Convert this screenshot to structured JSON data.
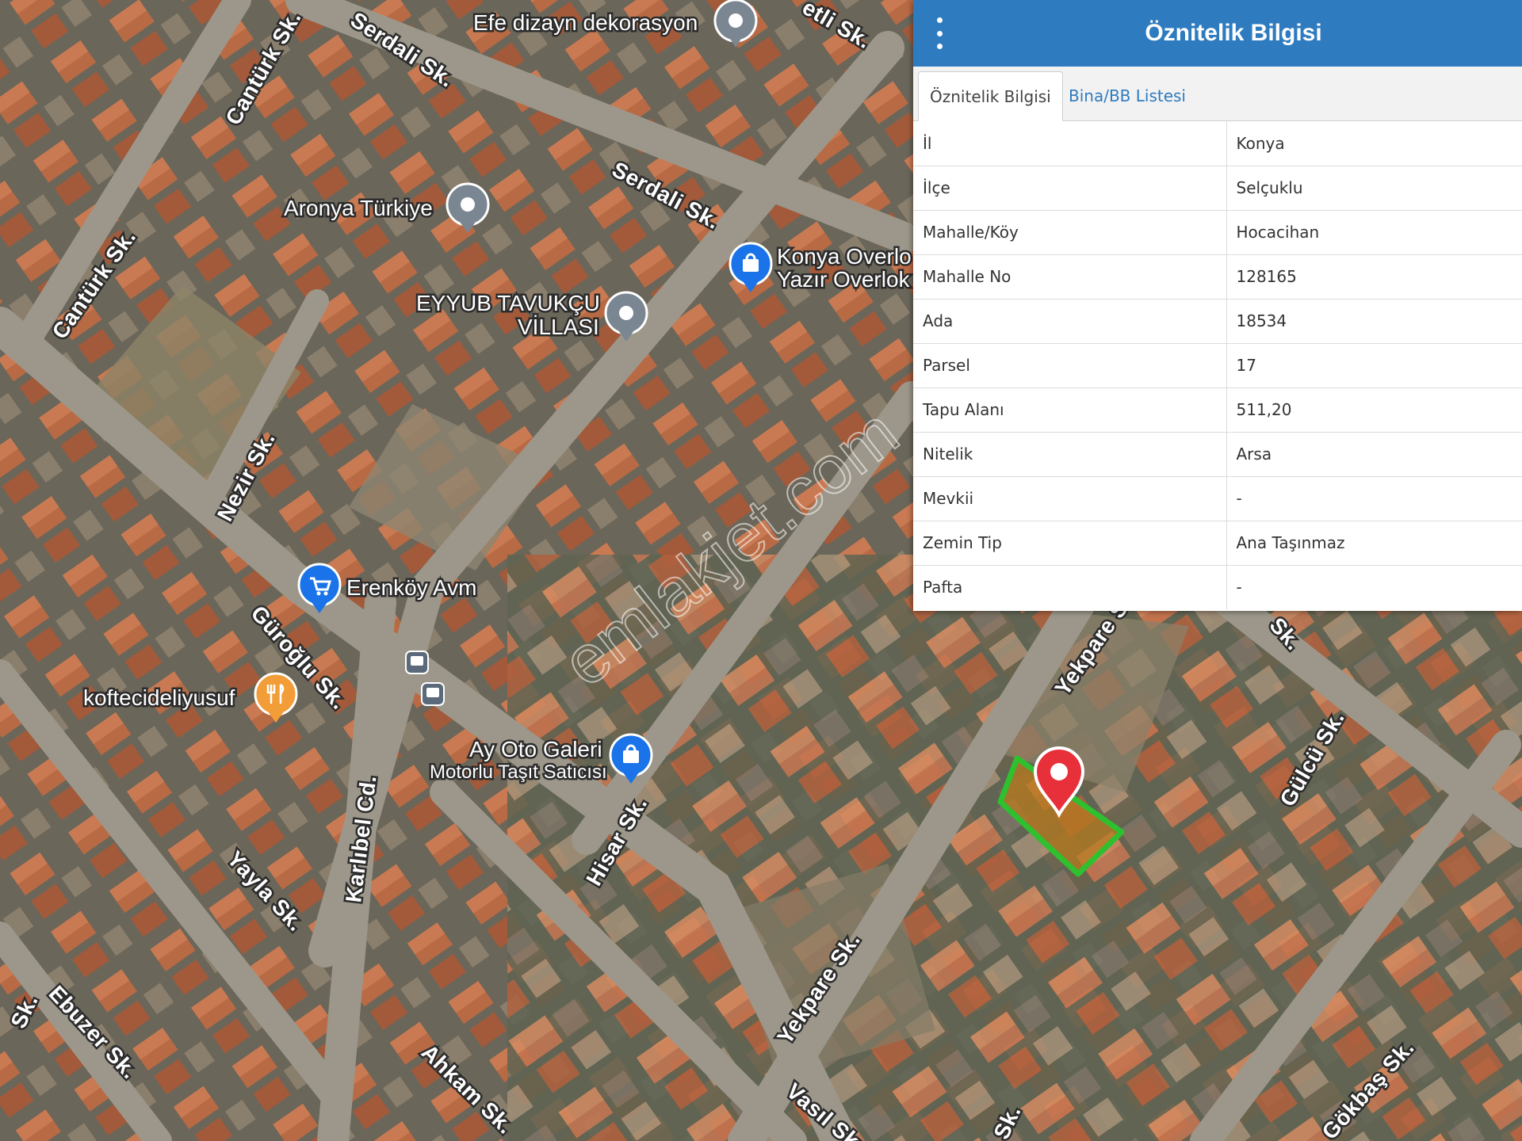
{
  "map": {
    "streets": [
      {
        "id": "serdali-1",
        "text": "Serdali Sk."
      },
      {
        "id": "serdali-2",
        "text": "Serdali Sk."
      },
      {
        "id": "canturk-1",
        "text": "Cantürk Sk."
      },
      {
        "id": "canturk-2",
        "text": "Cantürk Sk."
      },
      {
        "id": "nezir",
        "text": "Nezir Sk."
      },
      {
        "id": "guroglu",
        "text": "Güroğlu Sk."
      },
      {
        "id": "karlibel",
        "text": "Karlıbel Cd."
      },
      {
        "id": "yayla",
        "text": "Yayla Sk."
      },
      {
        "id": "ebuzer",
        "text": "Ebuzer Sk."
      },
      {
        "id": "ahkam",
        "text": "Ahkam Sk."
      },
      {
        "id": "hisar",
        "text": "Hisar Sk."
      },
      {
        "id": "yekpare-1",
        "text": "Yekpare Sk."
      },
      {
        "id": "yekpare-2",
        "text": "Yekpare Sk."
      },
      {
        "id": "vasil",
        "text": "Vasıl Sk."
      },
      {
        "id": "gulcu",
        "text": "Gülcü Sk."
      },
      {
        "id": "gokbas",
        "text": "Gökbaş Sk."
      },
      {
        "id": "top-sk",
        "text": "etli Sk."
      },
      {
        "id": "ipek-partial",
        "text": "Sk."
      },
      {
        "id": "left-partial",
        "text": "Sk."
      },
      {
        "id": "bottom-partial",
        "text": "Sk."
      }
    ],
    "pois": [
      {
        "id": "efe",
        "lines": [
          "Efe dizayn dekorasyon"
        ],
        "icon": "place-pin-icon",
        "color": "#7a8691"
      },
      {
        "id": "aronya",
        "lines": [
          "Aronya Türkiye"
        ],
        "icon": "place-pin-icon",
        "color": "#7a8691"
      },
      {
        "id": "konya-overlok",
        "lines": [
          "Konya Overlo",
          "Yazır Overlok"
        ],
        "icon": "shopping-bag-icon",
        "color": "#1a73e8"
      },
      {
        "id": "eyyub",
        "lines": [
          "EYYUB TAVUKÇU",
          "VİLLASI"
        ],
        "icon": "place-pin-icon",
        "color": "#7a8691"
      },
      {
        "id": "erenkoy",
        "lines": [
          "Erenköy Avm"
        ],
        "icon": "shopping-cart-icon",
        "color": "#1a73e8"
      },
      {
        "id": "koftecideliyusuf",
        "lines": [
          "koftecideliyusuf"
        ],
        "icon": "restaurant-icon",
        "color": "#f29d38"
      },
      {
        "id": "ay-oto",
        "lines": [
          "Ay Oto Galeri",
          "Motorlu Taşıt Satıcısı"
        ],
        "icon": "shopping-bag-icon",
        "color": "#1a73e8"
      }
    ],
    "watermark": "emlakjet.com",
    "parcel_outline_color": "#2ec02e",
    "marker_color": "#e8303a"
  },
  "panel": {
    "title": "Öznitelik Bilgisi",
    "tabs": [
      {
        "label": "Öznitelik Bilgisi",
        "active": true
      },
      {
        "label": "Bina/BB Listesi",
        "active": false
      }
    ],
    "rows": [
      {
        "key": "İl",
        "value": "Konya"
      },
      {
        "key": "İlçe",
        "value": "Selçuklu"
      },
      {
        "key": "Mahalle/Köy",
        "value": "Hocacihan"
      },
      {
        "key": "Mahalle No",
        "value": "128165"
      },
      {
        "key": "Ada",
        "value": "18534"
      },
      {
        "key": "Parsel",
        "value": "17"
      },
      {
        "key": "Tapu Alanı",
        "value": "511,20"
      },
      {
        "key": "Nitelik",
        "value": "Arsa"
      },
      {
        "key": "Mevkii",
        "value": "-"
      },
      {
        "key": "Zemin Tip",
        "value": "Ana Taşınmaz"
      },
      {
        "key": "Pafta",
        "value": "-"
      }
    ],
    "header_color": "#2f7bbf"
  }
}
